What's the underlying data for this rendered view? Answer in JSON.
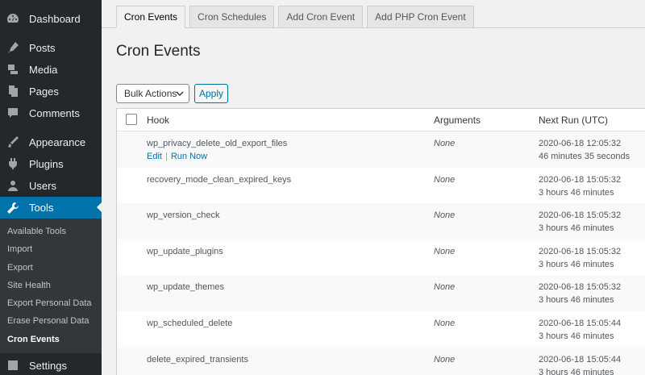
{
  "sidebar": {
    "dashboard": "Dashboard",
    "posts": "Posts",
    "media": "Media",
    "pages": "Pages",
    "comments": "Comments",
    "appearance": "Appearance",
    "plugins": "Plugins",
    "users": "Users",
    "tools": "Tools",
    "settings": "Settings",
    "tools_submenu": [
      "Available Tools",
      "Import",
      "Export",
      "Site Health",
      "Export Personal Data",
      "Erase Personal Data",
      "Cron Events"
    ]
  },
  "tabs": [
    "Cron Events",
    "Cron Schedules",
    "Add Cron Event",
    "Add PHP Cron Event"
  ],
  "page_title": "Cron Events",
  "bulk_actions": "Bulk Actions",
  "apply": "Apply",
  "table": {
    "headers": {
      "hook": "Hook",
      "arguments": "Arguments",
      "next_run": "Next Run (UTC)"
    },
    "row_actions": {
      "edit": "Edit",
      "sep": "|",
      "run_now": "Run Now"
    },
    "rows": [
      {
        "hook": "wp_privacy_delete_old_export_files",
        "args": "None",
        "date": "2020-06-18 12:05:32",
        "relative": "46 minutes 35 seconds"
      },
      {
        "hook": "recovery_mode_clean_expired_keys",
        "args": "None",
        "date": "2020-06-18 15:05:32",
        "relative": "3 hours 46 minutes"
      },
      {
        "hook": "wp_version_check",
        "args": "None",
        "date": "2020-06-18 15:05:32",
        "relative": "3 hours 46 minutes"
      },
      {
        "hook": "wp_update_plugins",
        "args": "None",
        "date": "2020-06-18 15:05:32",
        "relative": "3 hours 46 minutes"
      },
      {
        "hook": "wp_update_themes",
        "args": "None",
        "date": "2020-06-18 15:05:32",
        "relative": "3 hours 46 minutes"
      },
      {
        "hook": "wp_scheduled_delete",
        "args": "None",
        "date": "2020-06-18 15:05:44",
        "relative": "3 hours 46 minutes"
      },
      {
        "hook": "delete_expired_transients",
        "args": "None",
        "date": "2020-06-18 15:05:44",
        "relative": "3 hours 46 minutes"
      }
    ]
  },
  "icons": [
    "dashboard-icon",
    "posts-icon",
    "media-icon",
    "pages-icon",
    "comments-icon",
    "appearance-icon",
    "plugins-icon",
    "users-icon",
    "tools-icon",
    "settings-icon"
  ],
  "colors": {
    "sidebar_bg": "#23282d",
    "active_bg": "#0073aa",
    "link": "#0073aa"
  }
}
